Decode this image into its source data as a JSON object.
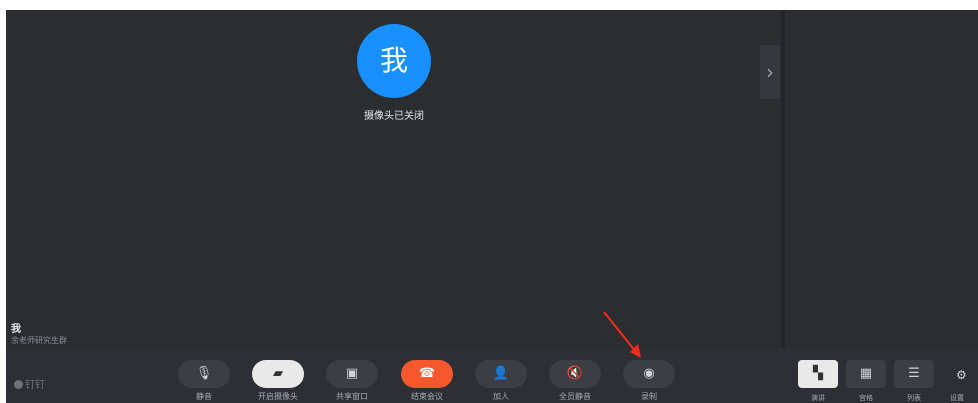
{
  "stage": {
    "avatar_text": "我",
    "camera_off_text": "摄像头已关闭",
    "participant_name": "我",
    "participant_sub": "余老师研究生群",
    "collapse_glyph": "›"
  },
  "brand": {
    "label": "钉钉"
  },
  "toolbar": {
    "buttons": [
      {
        "label": "静音",
        "icon": "🎙"
      },
      {
        "label": "开启摄像头",
        "icon": "▰"
      },
      {
        "label": "共享窗口",
        "icon": "▣"
      },
      {
        "label": "结束会议",
        "icon": "☎"
      },
      {
        "label": "加人",
        "icon": "👤"
      },
      {
        "label": "全员静音",
        "icon": "🔇"
      },
      {
        "label": "录制",
        "icon": "◉"
      }
    ]
  },
  "views": {
    "items": [
      {
        "label": "演讲",
        "icon": "▚"
      },
      {
        "label": "宫格",
        "icon": "▦"
      },
      {
        "label": "列表",
        "icon": "☰"
      }
    ],
    "settings_label": "设置",
    "settings_icon": "⚙"
  },
  "colors": {
    "accent": "#1890ff",
    "end_call": "#f5582d",
    "annotation_arrow": "#ff2a1a"
  }
}
